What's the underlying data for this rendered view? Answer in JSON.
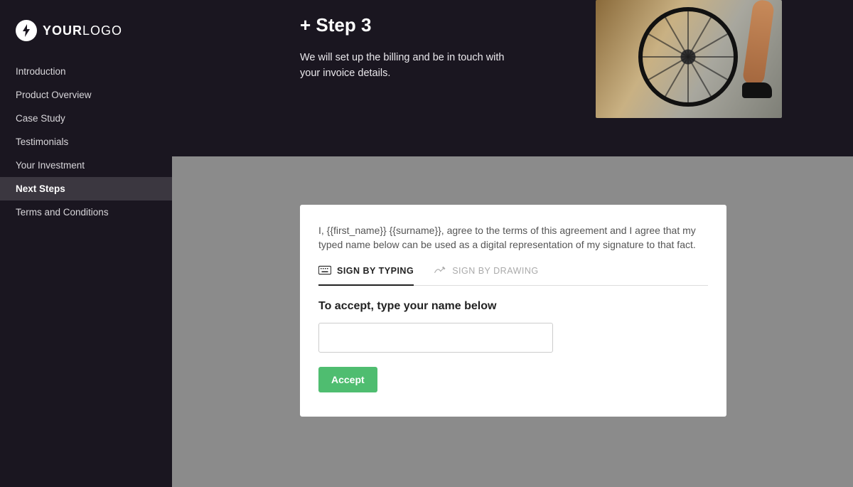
{
  "brand": {
    "logo_strong": "YOUR",
    "logo_light": "LOGO"
  },
  "sidebar": {
    "items": [
      {
        "label": "Introduction"
      },
      {
        "label": "Product Overview"
      },
      {
        "label": "Case Study"
      },
      {
        "label": "Testimonials"
      },
      {
        "label": "Your Investment"
      },
      {
        "label": "Next Steps"
      },
      {
        "label": "Terms and Conditions"
      }
    ],
    "active_index": 5
  },
  "step": {
    "title": "+ Step 3",
    "body": "We will set up the billing and be in touch with your invoice details."
  },
  "signature": {
    "agreement_text": "I, {{first_name}} {{surname}}, agree to the terms of this agreement and I agree that my typed name below can be used as a digital representation of my signature to that fact.",
    "tabs": {
      "typing": "SIGN BY TYPING",
      "drawing": "SIGN BY DRAWING"
    },
    "prompt": "To accept, type your name below",
    "input_value": "",
    "accept_label": "Accept"
  }
}
